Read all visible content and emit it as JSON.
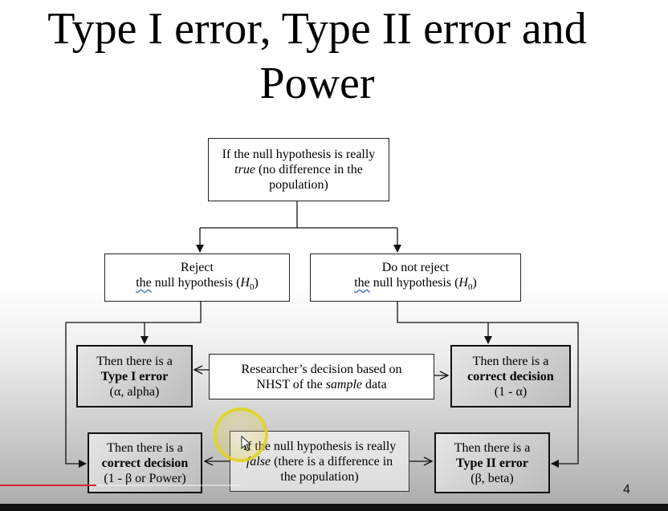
{
  "slide": {
    "title_line1": "Type I error, Type II error and",
    "title_line2": "Power",
    "page_number": "4"
  },
  "flowchart": {
    "null_true": {
      "line1": "If the null hypothesis is really",
      "line2_em": "true",
      "line2_rest": " (no difference in the",
      "line3": "population)"
    },
    "reject": {
      "line1": "Reject",
      "line2_the": "the",
      "line2_rest": " null hypothesis (",
      "h0": "H",
      "h0_sub": "0",
      "close": ")"
    },
    "not_reject": {
      "line1": "Do not reject",
      "line2_the": "the",
      "line2_rest": " null hypothesis (",
      "h0": "H",
      "h0_sub": "0",
      "close": ")"
    },
    "type1": {
      "line1": "Then there is a",
      "line2": "Type I error",
      "line3": "(α, alpha)"
    },
    "decision_basis": {
      "line1": "Researcher’s decision based on",
      "line2_pre": "NHST of the ",
      "line2_em": "sample",
      "line2_post": " data"
    },
    "correct_left": {
      "line1": "Then there is a",
      "line2": "correct decision",
      "line3": "(1 - α)"
    },
    "power": {
      "line1": "Then there is a",
      "line2": "correct decision",
      "line3": "(1 - β or Power)"
    },
    "null_false": {
      "line1": "If the null hypothesis is really",
      "line2_em": "false",
      "line2_rest": " (there is a difference in",
      "line3": "the population)"
    },
    "type2": {
      "line1": "Then there is a",
      "line2": "Type II error",
      "line3": "(β, beta)"
    }
  },
  "colors": {
    "cursor_highlight": "#e4d21e",
    "progress_played": "#d9262b",
    "bottom_bar": "#111111"
  }
}
